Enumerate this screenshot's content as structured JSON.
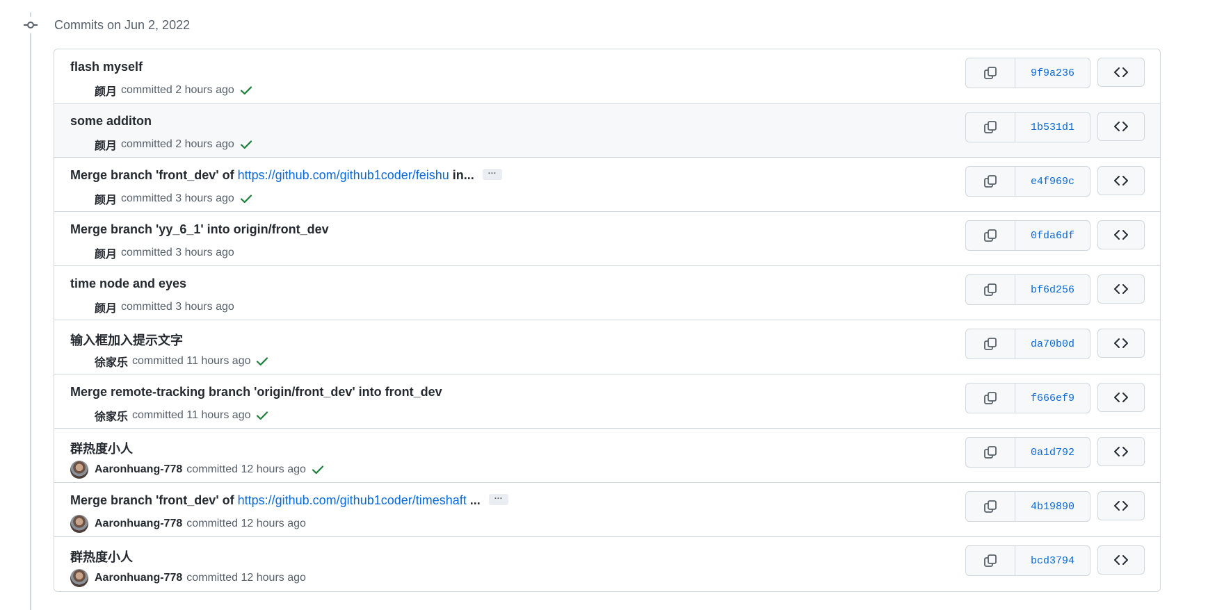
{
  "group": {
    "title": "Commits on Jun 2, 2022"
  },
  "commits": [
    {
      "message": "flash myself",
      "author": "颜月",
      "verb": "committed",
      "time": "2 hours ago",
      "check": true,
      "avatar": false,
      "sha": "9f9a236"
    },
    {
      "message": "some additon",
      "author": "颜月",
      "verb": "committed",
      "time": "2 hours ago",
      "check": true,
      "avatar": false,
      "sha": "1b531d1"
    },
    {
      "message_prefix": "Merge branch 'front_dev' of ",
      "link": "https://github.com/github1coder/feishu",
      "message_suffix": " in...",
      "ellipsis": "···",
      "author": "颜月",
      "verb": "committed",
      "time": "3 hours ago",
      "check": true,
      "avatar": false,
      "sha": "e4f969c"
    },
    {
      "message": "Merge branch 'yy_6_1' into origin/front_dev",
      "author": "颜月",
      "verb": "committed",
      "time": "3 hours ago",
      "check": false,
      "avatar": false,
      "sha": "0fda6df"
    },
    {
      "message": "time node and eyes",
      "author": "颜月",
      "verb": "committed",
      "time": "3 hours ago",
      "check": false,
      "avatar": false,
      "sha": "bf6d256"
    },
    {
      "message": "输入框加入提示文字",
      "author": "徐家乐",
      "verb": "committed",
      "time": "11 hours ago",
      "check": true,
      "avatar": false,
      "sha": "da70b0d"
    },
    {
      "message": "Merge remote-tracking branch 'origin/front_dev' into front_dev",
      "author": "徐家乐",
      "verb": "committed",
      "time": "11 hours ago",
      "check": true,
      "avatar": false,
      "sha": "f666ef9"
    },
    {
      "message": "群热度小人",
      "author": "Aaronhuang-778",
      "verb": "committed",
      "time": "12 hours ago",
      "check": true,
      "avatar": true,
      "sha": "0a1d792"
    },
    {
      "message_prefix": "Merge branch 'front_dev' of ",
      "link": "https://github.com/github1coder/timeshaft",
      "message_suffix": " ...",
      "ellipsis": "···",
      "author": "Aaronhuang-778",
      "verb": "committed",
      "time": "12 hours ago",
      "check": false,
      "avatar": true,
      "sha": "4b19890"
    },
    {
      "message": "群热度小人",
      "author": "Aaronhuang-778",
      "verb": "committed",
      "time": "12 hours ago",
      "check": false,
      "avatar": true,
      "sha": "bcd3794"
    }
  ],
  "icons": {
    "commit": "git-commit-icon",
    "copy": "copy-icon",
    "browse": "code-icon",
    "status": "check-icon"
  },
  "colors": {
    "link": "#0969da",
    "success": "#1a7f37",
    "border": "#d0d7de",
    "muted": "#57606a"
  }
}
